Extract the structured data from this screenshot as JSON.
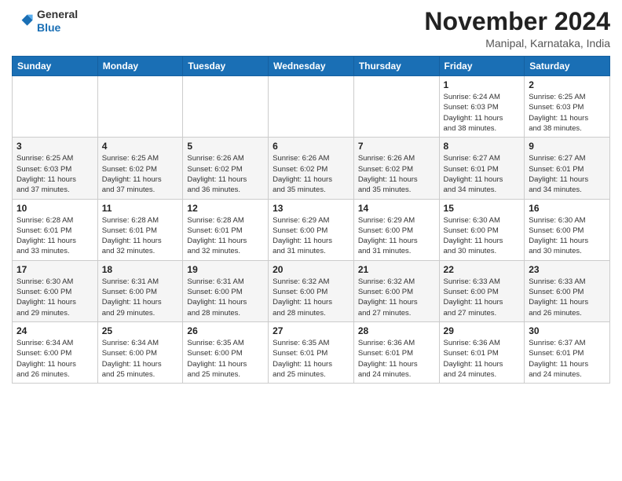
{
  "header": {
    "logo": {
      "line1": "General",
      "line2": "Blue"
    },
    "title": "November 2024",
    "location": "Manipal, Karnataka, India"
  },
  "weekdays": [
    "Sunday",
    "Monday",
    "Tuesday",
    "Wednesday",
    "Thursday",
    "Friday",
    "Saturday"
  ],
  "weeks": [
    [
      {
        "day": "",
        "info": ""
      },
      {
        "day": "",
        "info": ""
      },
      {
        "day": "",
        "info": ""
      },
      {
        "day": "",
        "info": ""
      },
      {
        "day": "",
        "info": ""
      },
      {
        "day": "1",
        "info": "Sunrise: 6:24 AM\nSunset: 6:03 PM\nDaylight: 11 hours\nand 38 minutes."
      },
      {
        "day": "2",
        "info": "Sunrise: 6:25 AM\nSunset: 6:03 PM\nDaylight: 11 hours\nand 38 minutes."
      }
    ],
    [
      {
        "day": "3",
        "info": "Sunrise: 6:25 AM\nSunset: 6:03 PM\nDaylight: 11 hours\nand 37 minutes."
      },
      {
        "day": "4",
        "info": "Sunrise: 6:25 AM\nSunset: 6:02 PM\nDaylight: 11 hours\nand 37 minutes."
      },
      {
        "day": "5",
        "info": "Sunrise: 6:26 AM\nSunset: 6:02 PM\nDaylight: 11 hours\nand 36 minutes."
      },
      {
        "day": "6",
        "info": "Sunrise: 6:26 AM\nSunset: 6:02 PM\nDaylight: 11 hours\nand 35 minutes."
      },
      {
        "day": "7",
        "info": "Sunrise: 6:26 AM\nSunset: 6:02 PM\nDaylight: 11 hours\nand 35 minutes."
      },
      {
        "day": "8",
        "info": "Sunrise: 6:27 AM\nSunset: 6:01 PM\nDaylight: 11 hours\nand 34 minutes."
      },
      {
        "day": "9",
        "info": "Sunrise: 6:27 AM\nSunset: 6:01 PM\nDaylight: 11 hours\nand 34 minutes."
      }
    ],
    [
      {
        "day": "10",
        "info": "Sunrise: 6:28 AM\nSunset: 6:01 PM\nDaylight: 11 hours\nand 33 minutes."
      },
      {
        "day": "11",
        "info": "Sunrise: 6:28 AM\nSunset: 6:01 PM\nDaylight: 11 hours\nand 32 minutes."
      },
      {
        "day": "12",
        "info": "Sunrise: 6:28 AM\nSunset: 6:01 PM\nDaylight: 11 hours\nand 32 minutes."
      },
      {
        "day": "13",
        "info": "Sunrise: 6:29 AM\nSunset: 6:00 PM\nDaylight: 11 hours\nand 31 minutes."
      },
      {
        "day": "14",
        "info": "Sunrise: 6:29 AM\nSunset: 6:00 PM\nDaylight: 11 hours\nand 31 minutes."
      },
      {
        "day": "15",
        "info": "Sunrise: 6:30 AM\nSunset: 6:00 PM\nDaylight: 11 hours\nand 30 minutes."
      },
      {
        "day": "16",
        "info": "Sunrise: 6:30 AM\nSunset: 6:00 PM\nDaylight: 11 hours\nand 30 minutes."
      }
    ],
    [
      {
        "day": "17",
        "info": "Sunrise: 6:30 AM\nSunset: 6:00 PM\nDaylight: 11 hours\nand 29 minutes."
      },
      {
        "day": "18",
        "info": "Sunrise: 6:31 AM\nSunset: 6:00 PM\nDaylight: 11 hours\nand 29 minutes."
      },
      {
        "day": "19",
        "info": "Sunrise: 6:31 AM\nSunset: 6:00 PM\nDaylight: 11 hours\nand 28 minutes."
      },
      {
        "day": "20",
        "info": "Sunrise: 6:32 AM\nSunset: 6:00 PM\nDaylight: 11 hours\nand 28 minutes."
      },
      {
        "day": "21",
        "info": "Sunrise: 6:32 AM\nSunset: 6:00 PM\nDaylight: 11 hours\nand 27 minutes."
      },
      {
        "day": "22",
        "info": "Sunrise: 6:33 AM\nSunset: 6:00 PM\nDaylight: 11 hours\nand 27 minutes."
      },
      {
        "day": "23",
        "info": "Sunrise: 6:33 AM\nSunset: 6:00 PM\nDaylight: 11 hours\nand 26 minutes."
      }
    ],
    [
      {
        "day": "24",
        "info": "Sunrise: 6:34 AM\nSunset: 6:00 PM\nDaylight: 11 hours\nand 26 minutes."
      },
      {
        "day": "25",
        "info": "Sunrise: 6:34 AM\nSunset: 6:00 PM\nDaylight: 11 hours\nand 25 minutes."
      },
      {
        "day": "26",
        "info": "Sunrise: 6:35 AM\nSunset: 6:00 PM\nDaylight: 11 hours\nand 25 minutes."
      },
      {
        "day": "27",
        "info": "Sunrise: 6:35 AM\nSunset: 6:01 PM\nDaylight: 11 hours\nand 25 minutes."
      },
      {
        "day": "28",
        "info": "Sunrise: 6:36 AM\nSunset: 6:01 PM\nDaylight: 11 hours\nand 24 minutes."
      },
      {
        "day": "29",
        "info": "Sunrise: 6:36 AM\nSunset: 6:01 PM\nDaylight: 11 hours\nand 24 minutes."
      },
      {
        "day": "30",
        "info": "Sunrise: 6:37 AM\nSunset: 6:01 PM\nDaylight: 11 hours\nand 24 minutes."
      }
    ]
  ]
}
